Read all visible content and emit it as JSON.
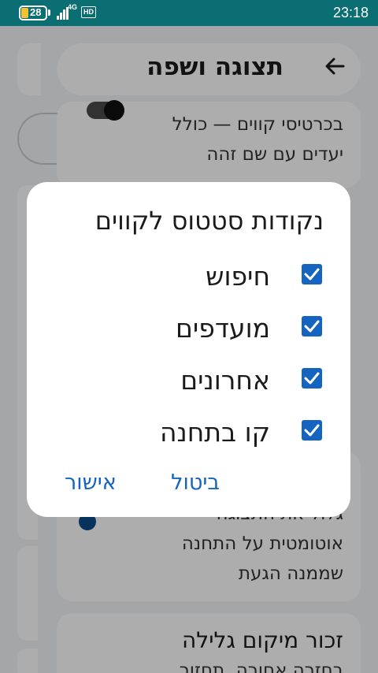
{
  "status_bar": {
    "battery": "28",
    "network": "4G",
    "hd_label": "HD",
    "time": "23:18"
  },
  "background": {
    "title": "תצוגה ושפה",
    "back_icon": "arrow-right-icon",
    "card1_line1": "בכרטיסי קווים — כולל",
    "card1_line2": "יעדים עם שם זהה",
    "card2_line0": "גלול את התצוגה",
    "card2_line1": "אוטומטית על התחנה",
    "card2_line2": "שממנה הגעת",
    "card3_title": "זכור מיקום גלילה",
    "card3_line1": "בחזרה אחורה, תחזור"
  },
  "dialog": {
    "title": "נקודות סטטוס לקווים",
    "options": [
      {
        "label": "חיפוש",
        "checked": true
      },
      {
        "label": "מועדפים",
        "checked": true
      },
      {
        "label": "אחרונים",
        "checked": true
      },
      {
        "label": "קו בתחנה",
        "checked": true
      }
    ],
    "confirm_label": "אישור",
    "cancel_label": "ביטול"
  },
  "colors": {
    "status_bar": "#0b6e73",
    "accent": "#1565c0"
  }
}
